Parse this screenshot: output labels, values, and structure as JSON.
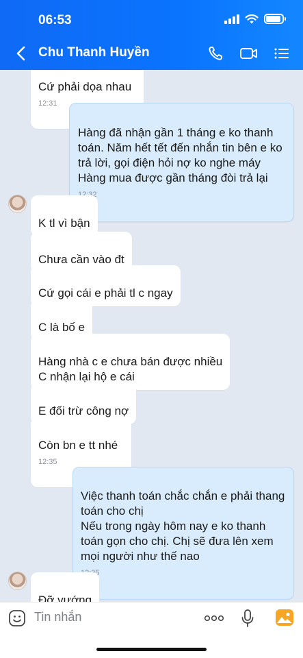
{
  "status_bar": {
    "time": "06:53",
    "battery_level": 0.9
  },
  "header": {
    "contact_name": "Chu Thanh Huyền",
    "icons": [
      "back-chevron-icon",
      "phone-icon",
      "video-call-icon",
      "menu-list-icon"
    ]
  },
  "messages": [
    {
      "direction": "incoming",
      "text": "Cứ phải dọa nhau",
      "time": "12:31"
    },
    {
      "direction": "outgoing",
      "text": "Hàng đã nhận gần 1 tháng e ko thanh toán. Năm hết tết đến nhắn tin bên e ko trả lời, gọi điện hỏi nợ ko nghe máy\nHàng mua được gần tháng đòi trả lại",
      "time": "12:32"
    },
    {
      "direction": "incoming",
      "text": "K tl vì bận"
    },
    {
      "direction": "incoming",
      "text": "Chưa cần vào đt"
    },
    {
      "direction": "incoming",
      "text": "Cứ gọi cái e phải tl c ngay"
    },
    {
      "direction": "incoming",
      "text": "C là bố e"
    },
    {
      "direction": "incoming",
      "text": "Hàng nhà c e chưa bán được nhiều\nC nhận lại hộ e cái"
    },
    {
      "direction": "incoming",
      "text": "E đối trừ công nợ"
    },
    {
      "direction": "incoming",
      "text": "Còn bn e tt nhé",
      "time": "12:35"
    },
    {
      "direction": "outgoing",
      "text": "Việc thanh toán chắc chắn e phải thang toán cho chị\nNếu trong ngày hôm nay e ko thanh toán gọn cho chị. Chị sẽ đưa lên xem mọi người như thế nao",
      "time": "12:35"
    },
    {
      "direction": "incoming",
      "text": "Đỡ vướng"
    }
  ],
  "input_bar": {
    "placeholder": "Tin nhắn",
    "icons": [
      "emoji-icon",
      "more-options-icon",
      "microphone-icon",
      "gallery-icon"
    ]
  },
  "colors": {
    "header_blue": "#0a74ff",
    "chat_background": "#e2e8f2",
    "outgoing_bubble": "#d8ecfd",
    "incoming_bubble": "#ffffff",
    "gallery_orange": "#f6a623"
  }
}
